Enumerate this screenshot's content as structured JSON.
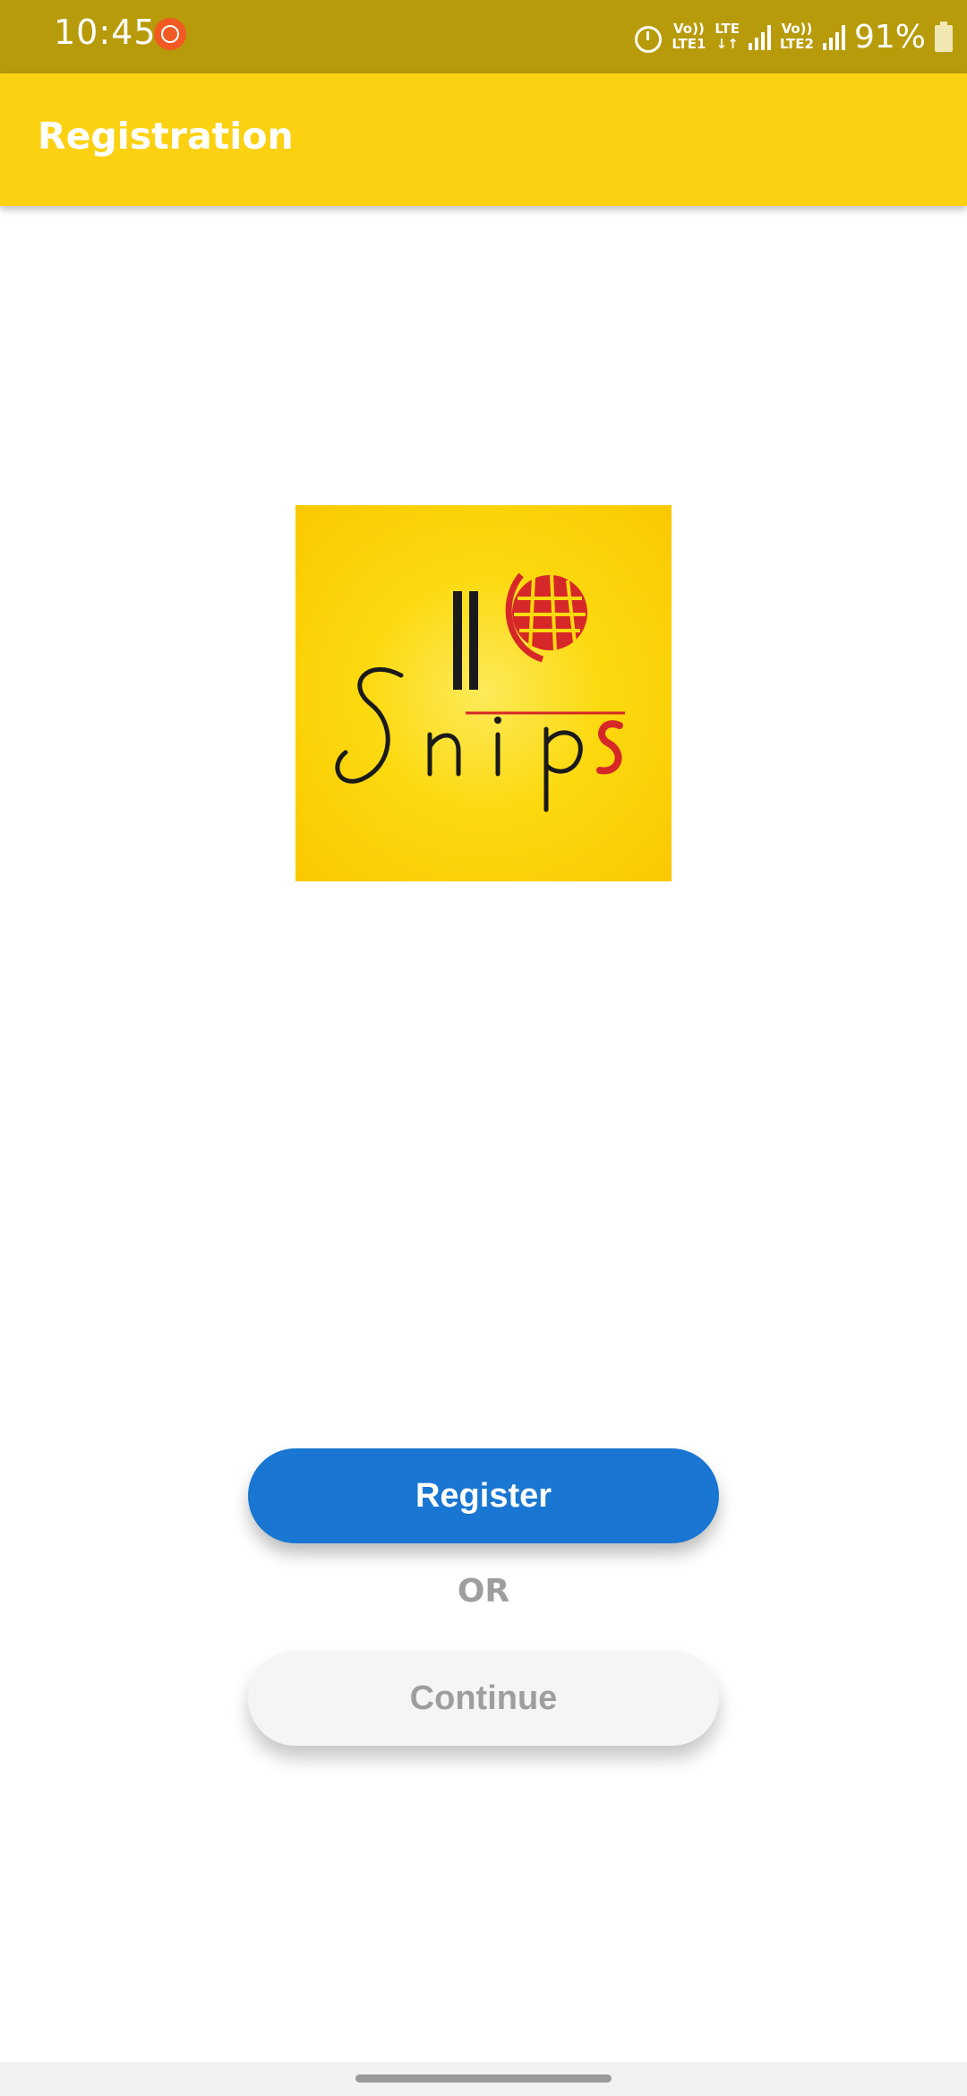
{
  "status_bar": {
    "time": "10:45",
    "sim1_line1": "Vo))",
    "sim1_line2": "LTE1",
    "data_line1": "LTE",
    "data_line2": "↓↑",
    "sim2_line1": "Vo))",
    "sim2_line2": "LTE2",
    "battery_percent": "91%"
  },
  "app_bar": {
    "title": "Registration"
  },
  "logo": {
    "brand_text": "Snips",
    "colors": {
      "background": "#fcd90f",
      "text": "#1a1a1a",
      "accent": "#d62828"
    }
  },
  "actions": {
    "register_label": "Register",
    "or_label": "OR",
    "continue_label": "Continue"
  },
  "colors": {
    "status_bar": "#b89b0a",
    "app_bar": "#fbd112",
    "primary_button": "#1976d2",
    "secondary_button": "#f5f5f5",
    "muted_text": "#9e9e9e"
  }
}
